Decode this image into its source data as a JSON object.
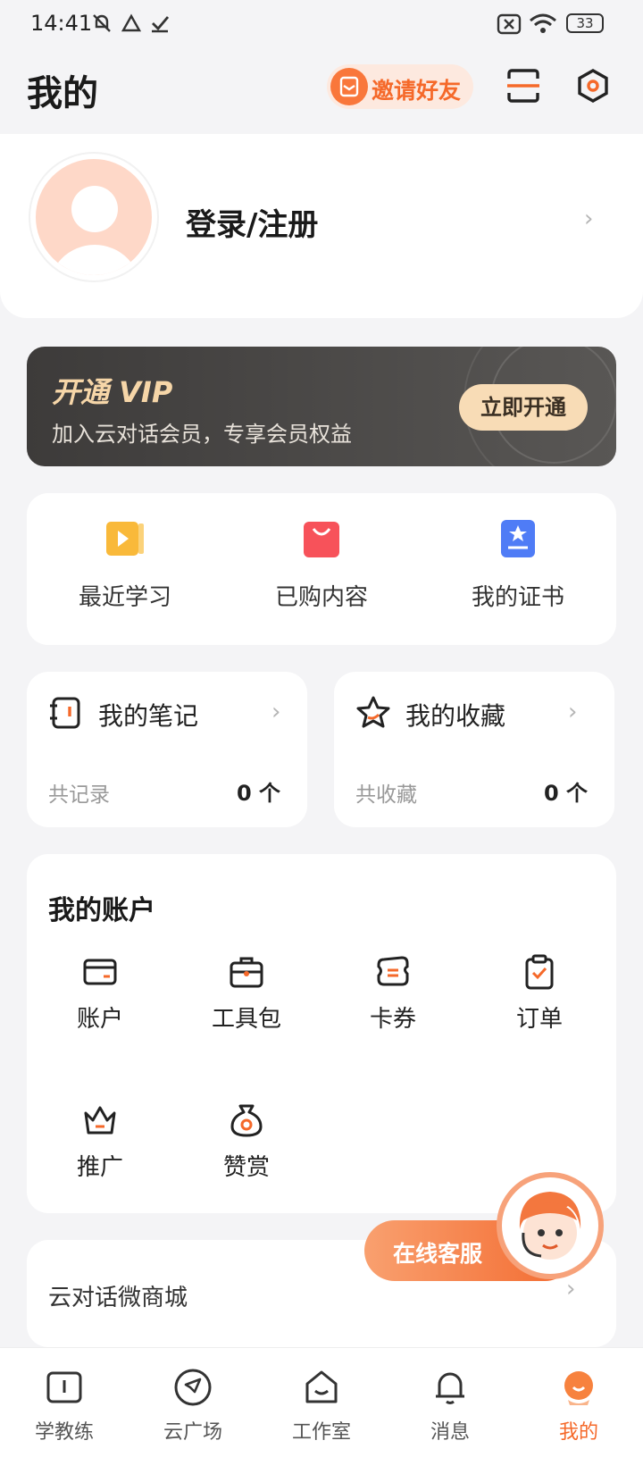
{
  "status_bar": {
    "time": "14:41",
    "battery": "33"
  },
  "header": {
    "title": "我的",
    "invite_label": "邀请好友"
  },
  "profile": {
    "login_label": "登录/注册"
  },
  "vip": {
    "title": "开通 VIP",
    "subtitle": "加入云对话会员，专享会员权益",
    "button": "立即开通"
  },
  "quick_links": [
    {
      "label": "最近学习",
      "icon": "play-book-icon",
      "color": "#f9b93a"
    },
    {
      "label": "已购内容",
      "icon": "shopping-bag-icon",
      "color": "#f7525a"
    },
    {
      "label": "我的证书",
      "icon": "certificate-icon",
      "color": "#4f7cf6"
    }
  ],
  "notes": {
    "title": "我的笔记",
    "sub": "共记录",
    "count": "0 个"
  },
  "favorites": {
    "title": "我的收藏",
    "sub": "共收藏",
    "count": "0 个"
  },
  "account": {
    "title": "我的账户",
    "items": [
      {
        "label": "账户",
        "icon": "card-icon"
      },
      {
        "label": "工具包",
        "icon": "toolbox-icon"
      },
      {
        "label": "卡券",
        "icon": "coupon-icon"
      },
      {
        "label": "订单",
        "icon": "clipboard-icon"
      },
      {
        "label": "推广",
        "icon": "crown-icon"
      },
      {
        "label": "赞赏",
        "icon": "money-bag-icon"
      }
    ]
  },
  "shop": {
    "label": "云对话微商城"
  },
  "service": {
    "label": "在线客服"
  },
  "tabs": [
    {
      "label": "学教练",
      "icon": "book-icon"
    },
    {
      "label": "云广场",
      "icon": "compass-icon"
    },
    {
      "label": "工作室",
      "icon": "house-icon"
    },
    {
      "label": "消息",
      "icon": "bell-icon"
    },
    {
      "label": "我的",
      "icon": "profile-icon",
      "active": true
    }
  ],
  "colors": {
    "accent": "#f5692a",
    "vip_gold": "#f8dcb6"
  }
}
